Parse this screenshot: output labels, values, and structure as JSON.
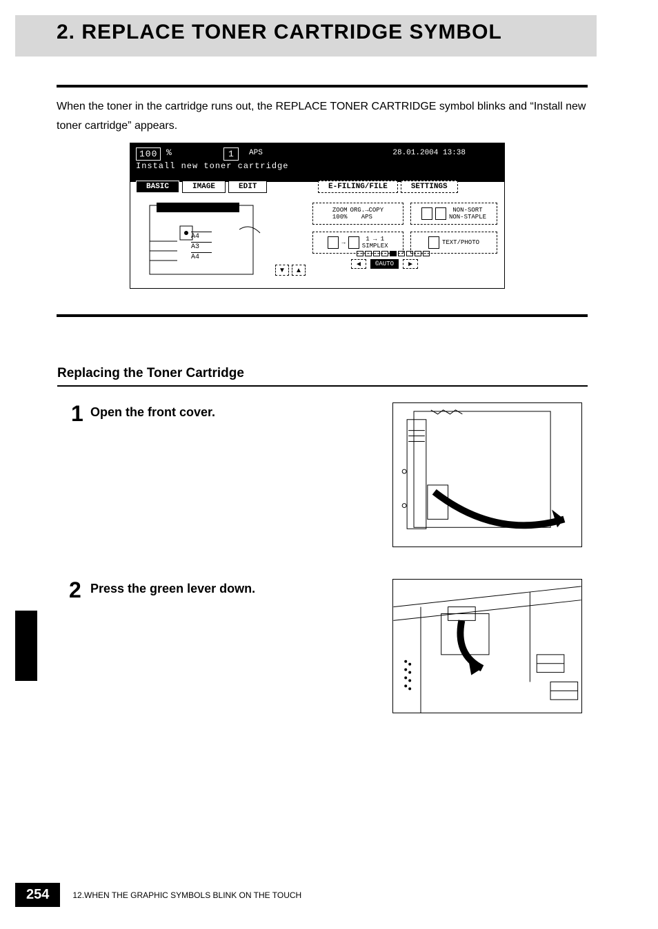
{
  "header": {
    "title": "2. REPLACE TONER CARTRIDGE SYMBOL"
  },
  "intro": "When the toner in the cartridge runs out, the REPLACE TONER CARTRIDGE symbol blinks and “Install new toner cartridge” appears.",
  "lcd": {
    "zoom_value": "100",
    "zoom_unit": "%",
    "copy_count": "1",
    "aps": "APS",
    "datetime": "28.01.2004 13:38",
    "message": "Install new toner cartridge",
    "tabs_left": [
      "BASIC",
      "IMAGE",
      "EDIT"
    ],
    "tabs_right": [
      "E-FILING/FILE",
      "SETTINGS"
    ],
    "paper_sizes": [
      "A4",
      "A3",
      "A4"
    ],
    "opt_zoom": {
      "line1": "ZOOM",
      "line2": "100%"
    },
    "opt_org": {
      "line1": "ORG.→COPY",
      "line2": "APS"
    },
    "opt_sort": {
      "line1": "NON-SORT",
      "line2": "NON-STAPLE"
    },
    "opt_simplex": {
      "line1": "1 → 1",
      "line2": "SIMPLEX"
    },
    "opt_mode": "TEXT/PHOTO",
    "auto_label": "©AUTO"
  },
  "section": {
    "title": "Replacing the Toner Cartridge"
  },
  "steps": [
    {
      "num": "1",
      "text": "Open the front cover."
    },
    {
      "num": "2",
      "text": "Press the green lever down."
    }
  ],
  "footer": {
    "page": "254",
    "chapter": "12.WHEN THE GRAPHIC SYMBOLS BLINK ON THE TOUCH"
  }
}
